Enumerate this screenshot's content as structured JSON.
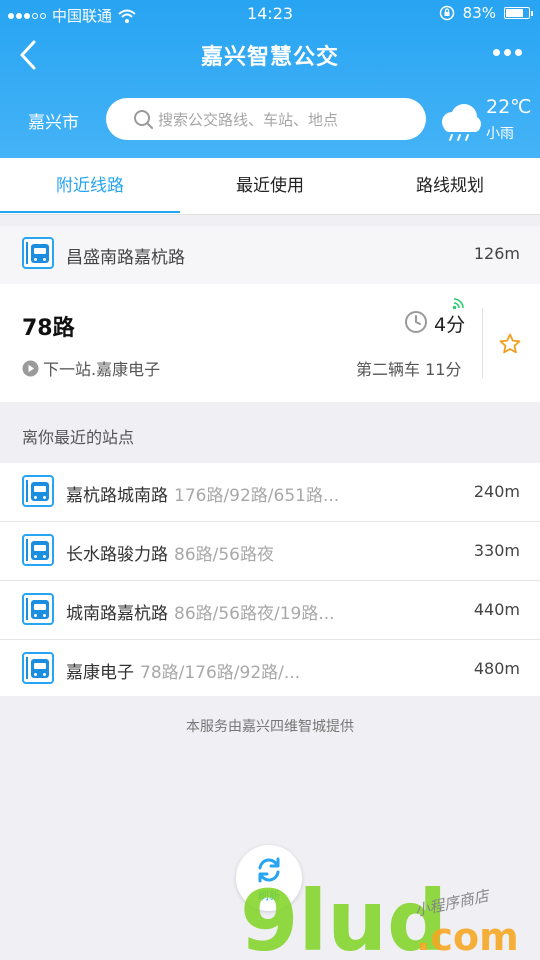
{
  "status_bar": {
    "carrier": "中国联通",
    "time": "14:23",
    "battery_percent": "83%",
    "battery_level": 0.83
  },
  "navbar": {
    "title": "嘉兴智慧公交",
    "back_icon": "chevron-left-icon",
    "more_icon": "more-dots-icon"
  },
  "search_bar": {
    "city": "嘉兴市",
    "placeholder": "搜索公交路线、车站、地点"
  },
  "weather": {
    "temp": "22℃",
    "desc": "小雨",
    "icon": "rain-cloud-icon"
  },
  "tabs": [
    {
      "label": "附近线路",
      "active": true
    },
    {
      "label": "最近使用",
      "active": false
    },
    {
      "label": "路线规划",
      "active": false
    }
  ],
  "nearby_stop": {
    "name": "昌盛南路嘉杭路",
    "distance": "126m"
  },
  "route_card": {
    "route": "78路",
    "arrival": "4分",
    "next_stop": "下一站.嘉康电子",
    "second_bus": "第二辆车 11分"
  },
  "nearest_section_title": "离你最近的站点",
  "nearest_stops": [
    {
      "name": "嘉杭路城南路",
      "lines": "176路/92路/651路...",
      "distance": "240m"
    },
    {
      "name": "长水路骏力路",
      "lines": "86路/56路夜",
      "distance": "330m"
    },
    {
      "name": "城南路嘉杭路",
      "lines": "86路/56路夜/19路...",
      "distance": "440m"
    },
    {
      "name": "嘉康电子",
      "lines": "78路/176路/92路/...",
      "distance": "480m"
    }
  ],
  "footer_text": "本服务由嘉兴四维智城提供",
  "refresh_label": "刷新",
  "watermark": {
    "main": "9lud",
    "suffix": ".com",
    "tagline": "小程序商店"
  },
  "colors": {
    "brand_blue": "#27a4f2",
    "background": "#efeff4",
    "star_orange": "#f0a020"
  }
}
